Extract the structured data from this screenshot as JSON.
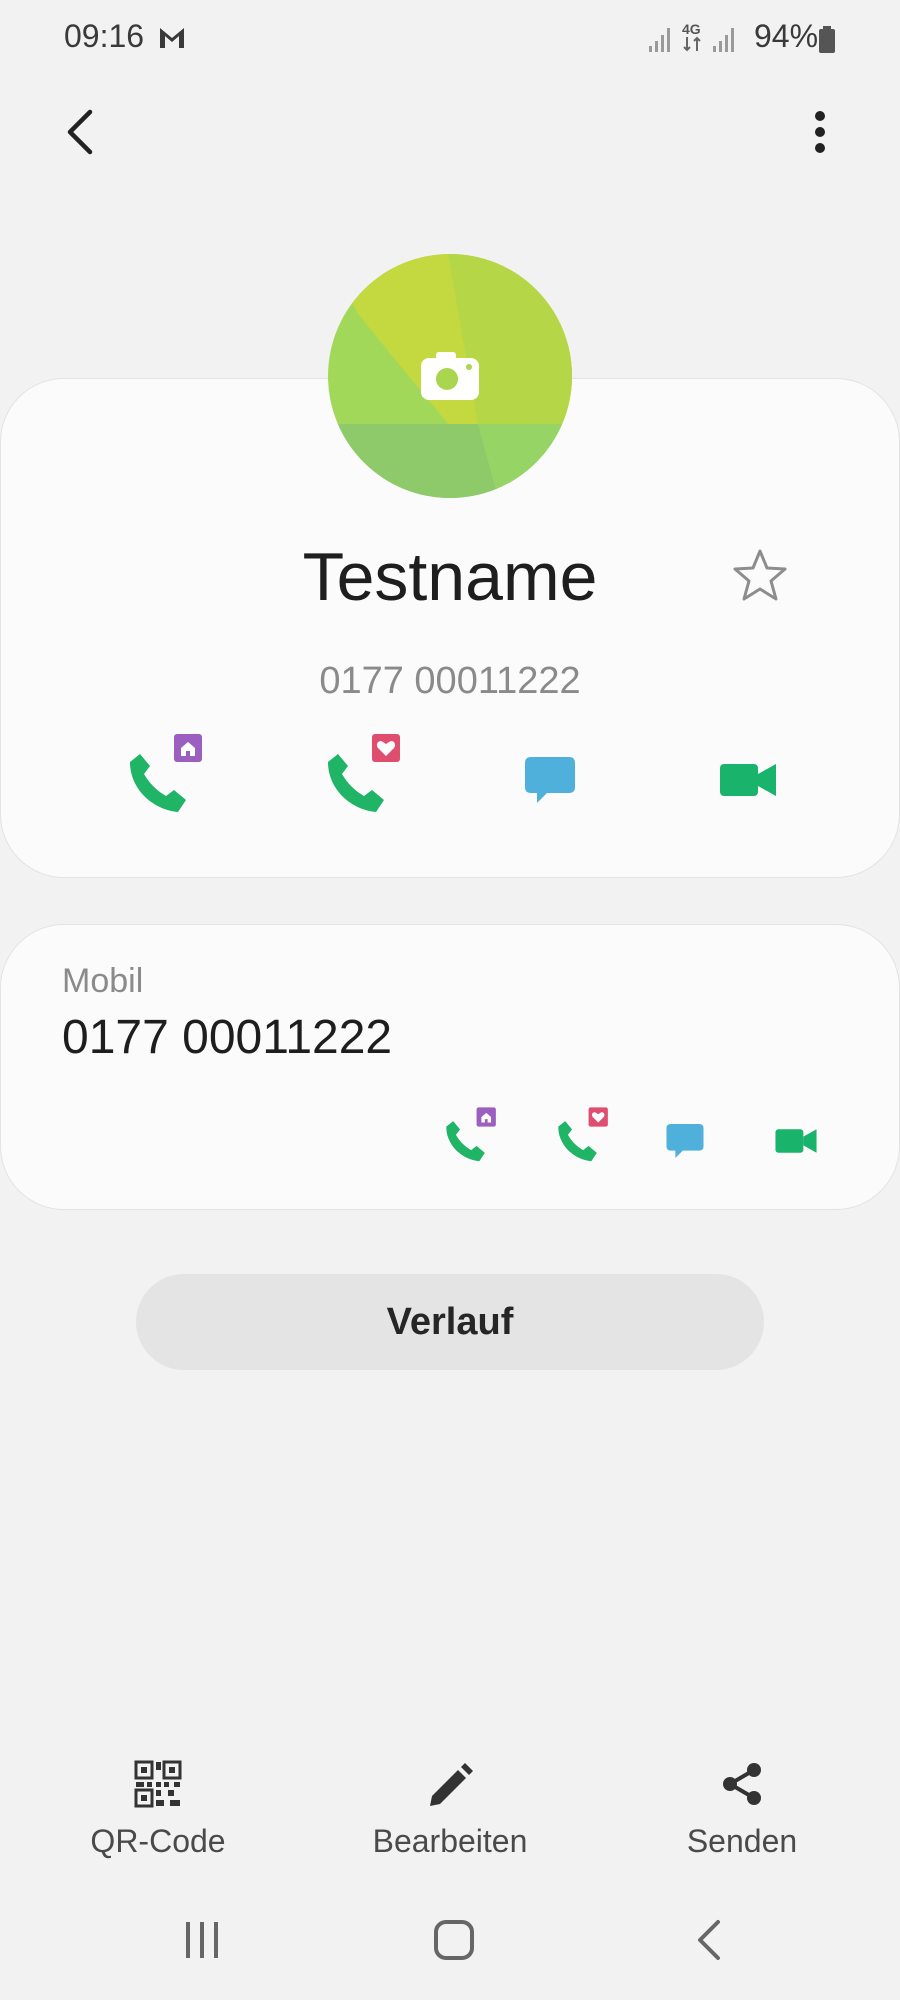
{
  "status_bar": {
    "time": "09:16",
    "network": "4G",
    "battery": "94%"
  },
  "top_bar": {
    "back_icon": "back-arrow-icon",
    "more_icon": "more-vertical-icon"
  },
  "contact": {
    "name": "Testname",
    "number": "0177 00011222",
    "avatar_icon": "camera-icon",
    "favorite_icon": "star-outline-icon"
  },
  "phone_entry": {
    "label": "Mobil",
    "number": "0177 00011222"
  },
  "history_button": "Verlauf",
  "toolbar": {
    "qr_label": "QR-Code",
    "edit_label": "Bearbeiten",
    "share_label": "Senden"
  },
  "colors": {
    "call_green": "#1fb466",
    "home_badge": "#9b5fc0",
    "fav_badge": "#e04e6f",
    "message_blue": "#4fb0dc",
    "video_green": "#19b36b",
    "avatar_green": "#a8d64e"
  }
}
